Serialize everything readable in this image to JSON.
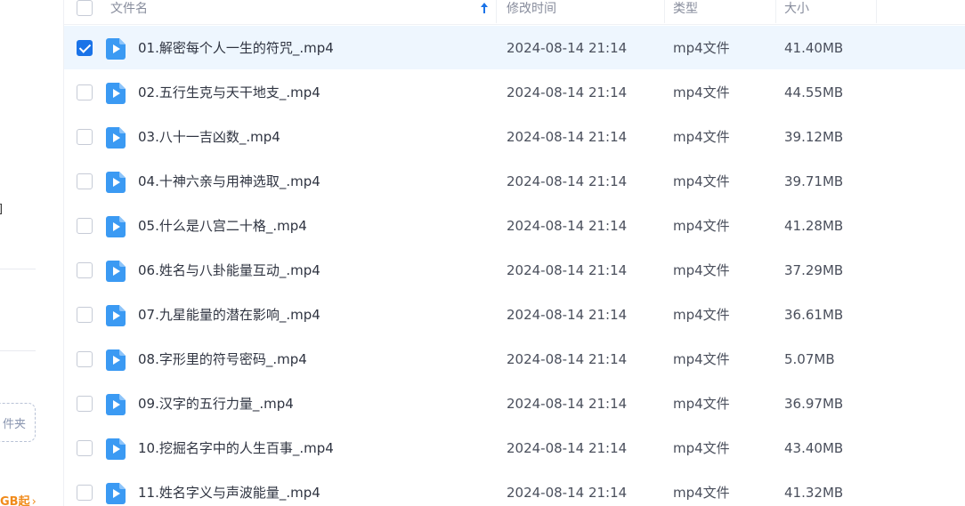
{
  "sidebar": {
    "bracket_fragment": "]",
    "folder_button_fragment": "件夹",
    "promo_fragment": "GB起"
  },
  "header": {
    "name": "文件名",
    "modified": "修改时间",
    "type": "类型",
    "size": "大小",
    "sort_icon": "arrow-up-icon"
  },
  "file_icon": "video-file-icon",
  "accent_color": "#1a73e8",
  "rows": [
    {
      "name": "01.解密每个人一生的符咒_.mp4",
      "date": "2024-08-14 21:14",
      "type": "mp4文件",
      "size": "41.40MB",
      "checked": true
    },
    {
      "name": "02.五行生克与天干地支_.mp4",
      "date": "2024-08-14 21:14",
      "type": "mp4文件",
      "size": "44.55MB",
      "checked": false
    },
    {
      "name": "03.八十一吉凶数_.mp4",
      "date": "2024-08-14 21:14",
      "type": "mp4文件",
      "size": "39.12MB",
      "checked": false
    },
    {
      "name": "04.十神六亲与用神选取_.mp4",
      "date": "2024-08-14 21:14",
      "type": "mp4文件",
      "size": "39.71MB",
      "checked": false
    },
    {
      "name": "05.什么是八宫二十格_.mp4",
      "date": "2024-08-14 21:14",
      "type": "mp4文件",
      "size": "41.28MB",
      "checked": false
    },
    {
      "name": "06.姓名与八卦能量互动_.mp4",
      "date": "2024-08-14 21:14",
      "type": "mp4文件",
      "size": "37.29MB",
      "checked": false
    },
    {
      "name": "07.九星能量的潜在影响_.mp4",
      "date": "2024-08-14 21:14",
      "type": "mp4文件",
      "size": "36.61MB",
      "checked": false
    },
    {
      "name": "08.字形里的符号密码_.mp4",
      "date": "2024-08-14 21:14",
      "type": "mp4文件",
      "size": "5.07MB",
      "checked": false
    },
    {
      "name": "09.汉字的五行力量_.mp4",
      "date": "2024-08-14 21:14",
      "type": "mp4文件",
      "size": "36.97MB",
      "checked": false
    },
    {
      "name": "10.挖掘名字中的人生百事_.mp4",
      "date": "2024-08-14 21:14",
      "type": "mp4文件",
      "size": "43.40MB",
      "checked": false
    },
    {
      "name": "11.姓名字义与声波能量_.mp4",
      "date": "2024-08-14 21:14",
      "type": "mp4文件",
      "size": "41.32MB",
      "checked": false
    }
  ]
}
